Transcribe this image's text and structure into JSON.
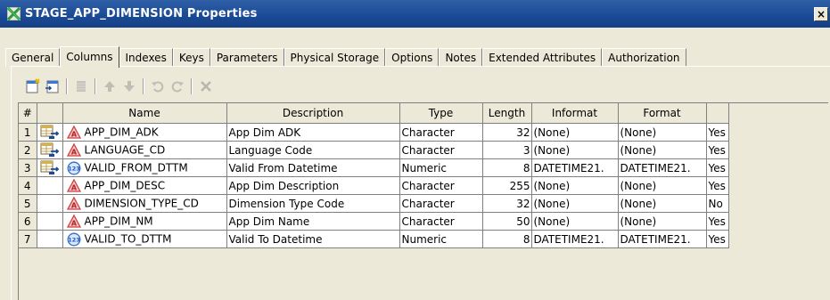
{
  "window": {
    "title": "STAGE_APP_DIMENSION Properties",
    "close_label": "×"
  },
  "tabs": [
    "General",
    "Columns",
    "Indexes",
    "Keys",
    "Parameters",
    "Physical Storage",
    "Options",
    "Notes",
    "Extended Attributes",
    "Authorization"
  ],
  "active_tab": "Columns",
  "toolbar": [
    "new-column-icon",
    "import-column-icon",
    "delete-column-icon",
    "move-up-icon",
    "move-down-icon",
    "undo-icon",
    "redo-icon",
    "remove-icon"
  ],
  "table": {
    "headers": [
      "#",
      "",
      "Name",
      "Description",
      "Type",
      "Length",
      "Informat",
      "Format",
      ""
    ],
    "rows": [
      {
        "num": "1",
        "key": true,
        "coltype": "character",
        "name": "APP_DIM_ADK",
        "description": "App Dim ADK",
        "type": "Character",
        "length": "32",
        "informat": "(None)",
        "format": "(None)",
        "nullable": "Yes"
      },
      {
        "num": "2",
        "key": true,
        "coltype": "character",
        "name": "LANGUAGE_CD",
        "description": "Language Code",
        "type": "Character",
        "length": "3",
        "informat": "(None)",
        "format": "(None)",
        "nullable": "Yes"
      },
      {
        "num": "3",
        "key": true,
        "coltype": "numeric",
        "name": "VALID_FROM_DTTM",
        "description": "Valid From Datetime",
        "type": "Numeric",
        "length": "8",
        "informat": "DATETIME21.",
        "format": "DATETIME21.",
        "nullable": "Yes"
      },
      {
        "num": "4",
        "key": false,
        "coltype": "character",
        "name": "APP_DIM_DESC",
        "description": "App Dim Description",
        "type": "Character",
        "length": "255",
        "informat": "(None)",
        "format": "(None)",
        "nullable": "Yes"
      },
      {
        "num": "5",
        "key": false,
        "coltype": "character",
        "name": "DIMENSION_TYPE_CD",
        "description": "Dimension Type Code",
        "type": "Character",
        "length": "32",
        "informat": "(None)",
        "format": "(None)",
        "nullable": "No"
      },
      {
        "num": "6",
        "key": false,
        "coltype": "character",
        "name": "APP_DIM_NM",
        "description": "App Dim Name",
        "type": "Character",
        "length": "50",
        "informat": "(None)",
        "format": "(None)",
        "nullable": "Yes"
      },
      {
        "num": "7",
        "key": false,
        "coltype": "numeric",
        "name": "VALID_TO_DTTM",
        "description": "Valid To Datetime",
        "type": "Numeric",
        "length": "8",
        "informat": "DATETIME21.",
        "format": "DATETIME21.",
        "nullable": "Yes"
      }
    ]
  },
  "colors": {
    "title_bg": "#1a4a95",
    "window_bg": "#ece9d8",
    "char_icon": "#d23c3c",
    "numeric_icon": "#2f6fd0"
  }
}
